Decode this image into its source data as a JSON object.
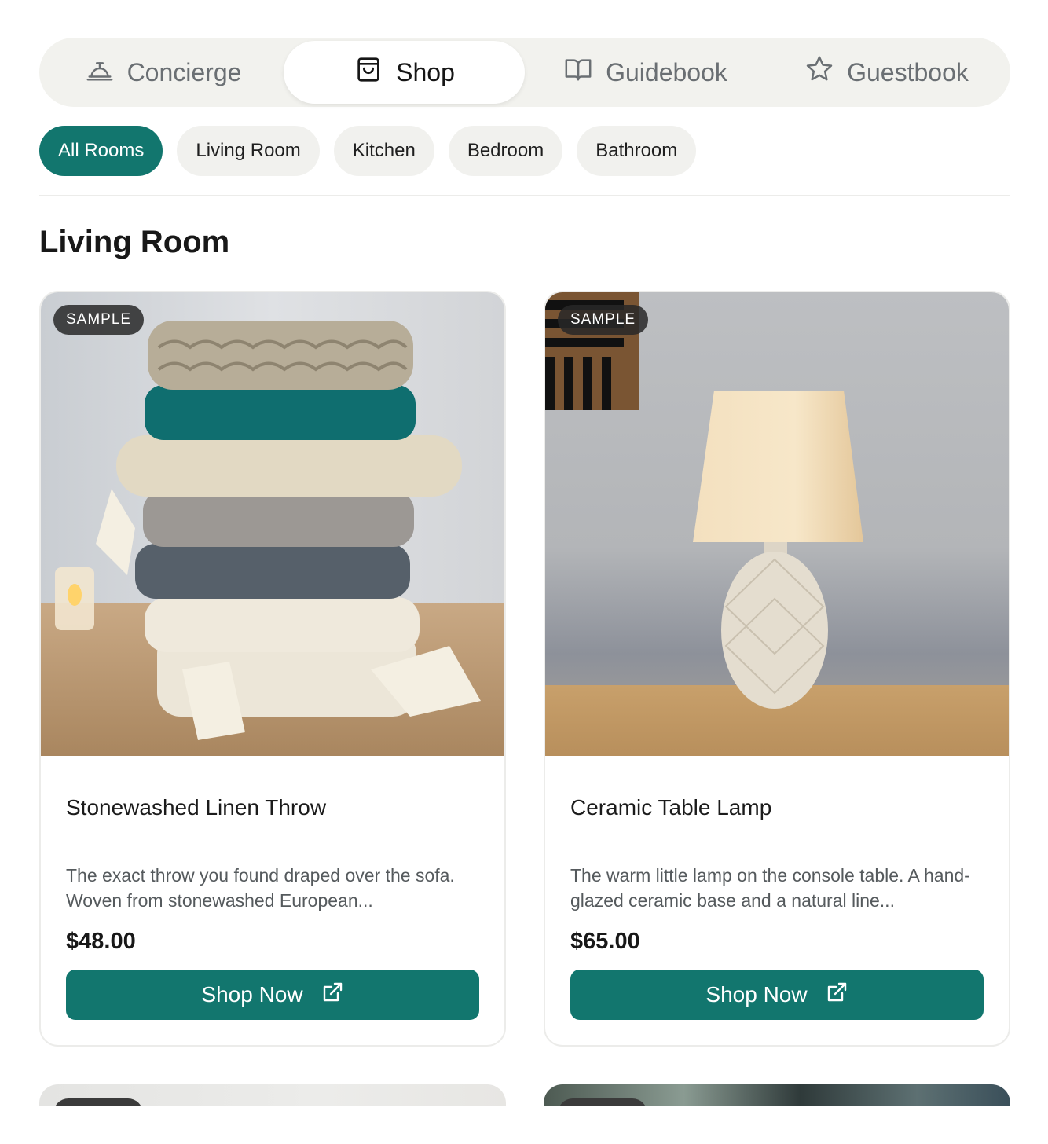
{
  "tabs": [
    {
      "label": "Concierge",
      "icon": "concierge-bell-icon"
    },
    {
      "label": "Shop",
      "icon": "shopping-bag-icon",
      "active": true
    },
    {
      "label": "Guidebook",
      "icon": "open-book-icon"
    },
    {
      "label": "Guestbook",
      "icon": "star-icon"
    }
  ],
  "filters": [
    "All Rooms",
    "Living Room",
    "Kitchen",
    "Bedroom",
    "Bathroom"
  ],
  "active_filter": "All Rooms",
  "section": {
    "title": "Living Room"
  },
  "products": [
    {
      "badge": "SAMPLE",
      "title": "Stonewashed Linen Throw",
      "description": "The exact throw you found draped over the sofa. Woven from stonewashed European...",
      "price": "$48.00",
      "button": "Shop Now"
    },
    {
      "badge": "SAMPLE",
      "title": "Ceramic Table Lamp",
      "description": "The warm little lamp on the console table. A hand-glazed ceramic base and a natural line...",
      "price": "$65.00",
      "button": "Shop Now"
    }
  ],
  "colors": {
    "accent": "#12766e",
    "chip_bg": "#f1f1ee",
    "tabbar_bg": "#f2f2ee"
  }
}
